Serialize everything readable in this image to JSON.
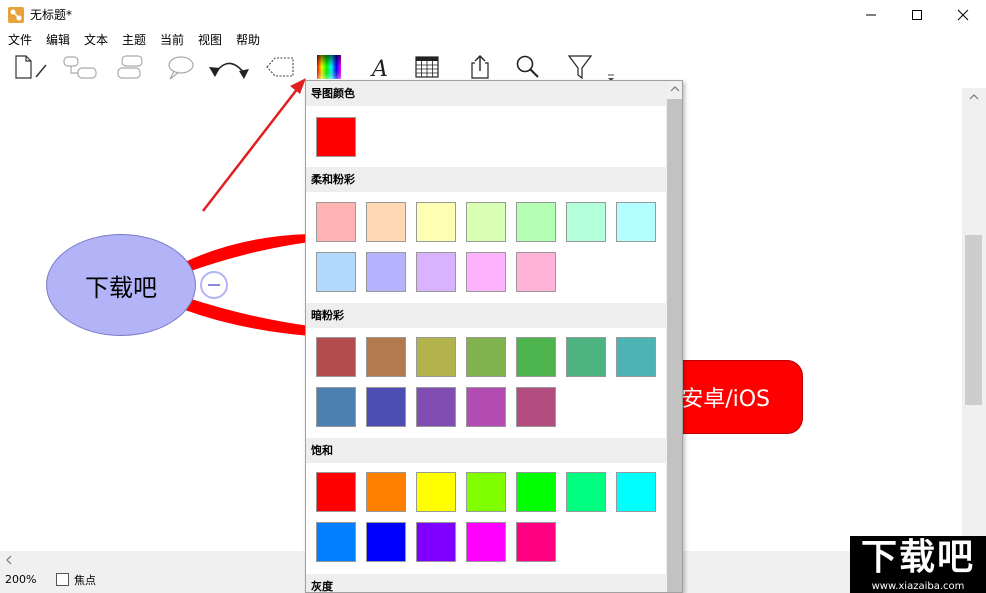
{
  "window": {
    "title": "无标题*"
  },
  "menu": [
    "文件",
    "编辑",
    "文本",
    "主题",
    "当前",
    "视图",
    "帮助"
  ],
  "toolbar": {
    "icons": [
      "new-document-icon",
      "add-subtopic-icon",
      "add-sibling-icon",
      "callout-icon",
      "undo-redo-icon",
      "boundary-icon",
      "color-palette-icon",
      "font-icon",
      "calendar-icon",
      "share-icon",
      "search-icon",
      "filter-icon",
      "overflow-icon"
    ]
  },
  "mindmap": {
    "central": {
      "label": "下载吧",
      "color": "#b3b3f8"
    },
    "child": {
      "label": "安卓/iOS",
      "visible_label": "安卓/iOS",
      "color": "#ff0000"
    }
  },
  "color_popup": {
    "sections": [
      {
        "name": "导图颜色",
        "colors": [
          "#ff0000"
        ]
      },
      {
        "name": "柔和粉彩",
        "colors": [
          "#ffb3b3",
          "#ffd9b3",
          "#ffffb3",
          "#d9ffb3",
          "#b3ffb3",
          "#b3ffd9",
          "#b3ffff",
          "#b3d9ff",
          "#b3b3ff",
          "#d9b3ff",
          "#ffb3ff",
          "#ffb3d9"
        ]
      },
      {
        "name": "暗粉彩",
        "colors": [
          "#b34d4d",
          "#b37a4d",
          "#b3b34d",
          "#80b34d",
          "#4db34d",
          "#4db380",
          "#4db3b3",
          "#4d80b3",
          "#4d4db3",
          "#804db3",
          "#b34db3",
          "#b34d80"
        ]
      },
      {
        "name": "饱和",
        "colors": [
          "#ff0000",
          "#ff8000",
          "#ffff00",
          "#80ff00",
          "#00ff00",
          "#00ff80",
          "#00ffff",
          "#0080ff",
          "#0000ff",
          "#8000ff",
          "#ff00ff",
          "#ff0080"
        ]
      },
      {
        "name": "灰度",
        "colors": []
      }
    ]
  },
  "status": {
    "zoom": "200%",
    "focus_label": "焦点"
  },
  "watermark": {
    "logo": "下载吧",
    "url": "www.xiazaiba.com"
  }
}
